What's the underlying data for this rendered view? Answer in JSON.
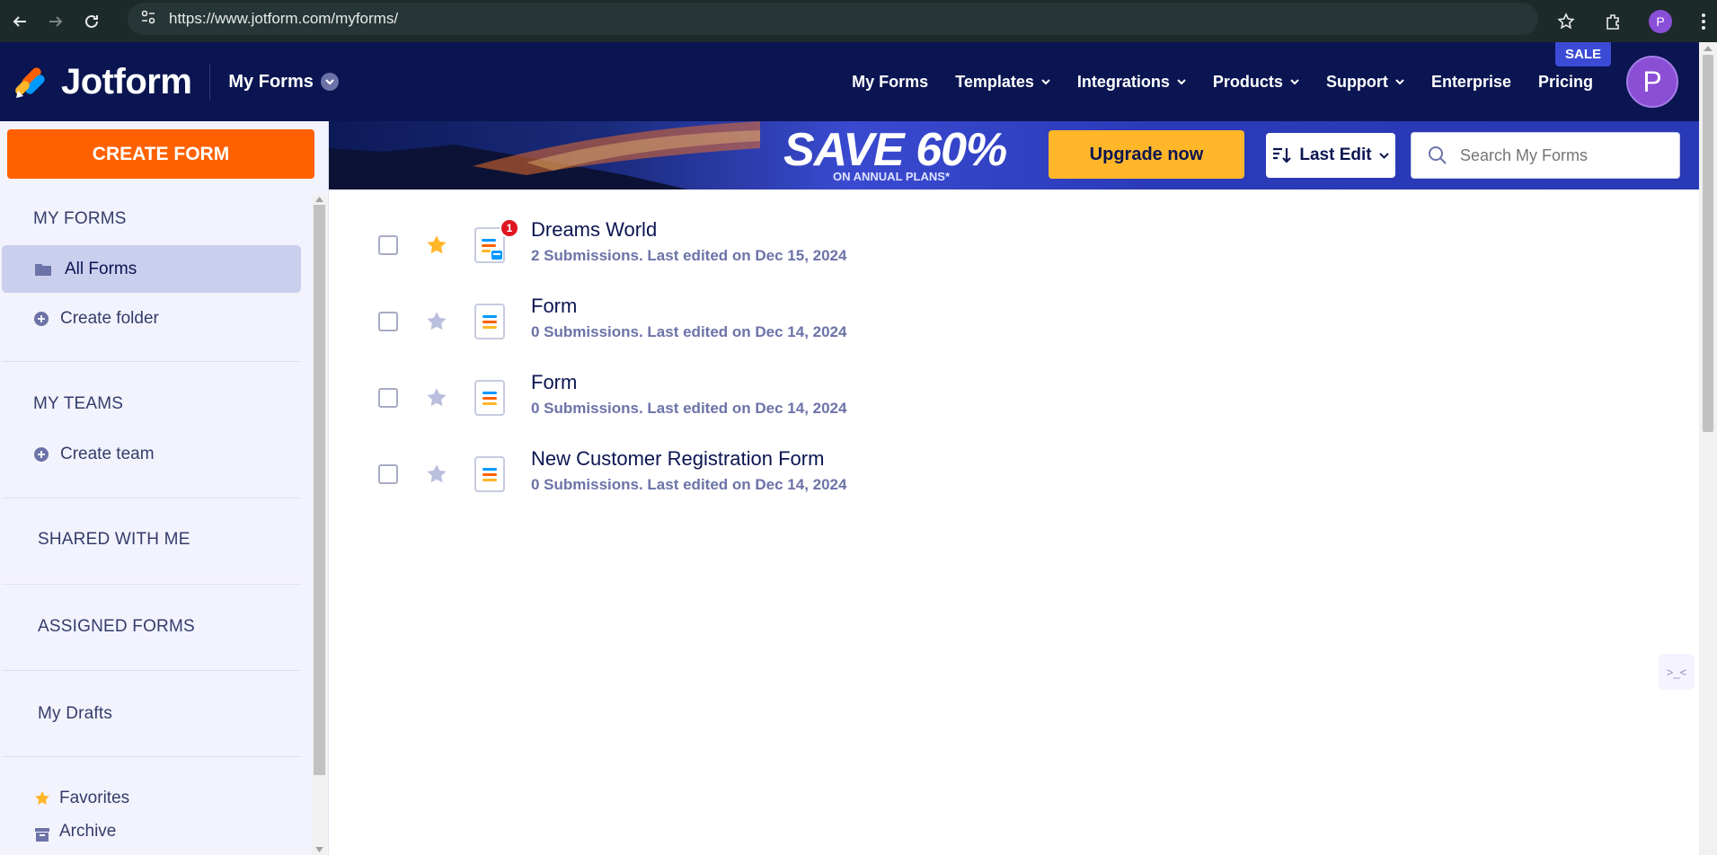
{
  "browser": {
    "url": "https://www.jotform.com/myforms/",
    "profile_initial": "P"
  },
  "header": {
    "brand": "Jotform",
    "workspace": "My Forms",
    "nav": [
      {
        "label": "My Forms"
      },
      {
        "label": "Templates"
      },
      {
        "label": "Integrations"
      },
      {
        "label": "Products"
      },
      {
        "label": "Support"
      },
      {
        "label": "Enterprise"
      },
      {
        "label": "Pricing"
      }
    ],
    "sale_badge": "SALE",
    "avatar_initial": "P"
  },
  "sidebar": {
    "create_form": "CREATE FORM",
    "my_forms_title": "MY FORMS",
    "all_forms": "All Forms",
    "create_folder": "Create folder",
    "my_teams_title": "MY TEAMS",
    "create_team": "Create team",
    "shared_with_me": "SHARED WITH ME",
    "assigned_forms": "ASSIGNED FORMS",
    "my_drafts": "My Drafts",
    "favorites": "Favorites",
    "archive": "Archive"
  },
  "banner": {
    "headline": "SAVE 60%",
    "subline": "ON ANNUAL PLANS*",
    "upgrade": "Upgrade now"
  },
  "toolbar": {
    "sort_label": "Last Edit",
    "search_placeholder": "Search My Forms"
  },
  "forms": [
    {
      "title": "Dreams World",
      "meta": "2 Submissions. Last edited on Dec 15, 2024",
      "starred": true,
      "badge": "1"
    },
    {
      "title": "Form",
      "meta": "0 Submissions. Last edited on Dec 14, 2024",
      "starred": false
    },
    {
      "title": "Form",
      "meta": "0 Submissions. Last edited on Dec 14, 2024",
      "starred": false
    },
    {
      "title": "New Customer Registration Form",
      "meta": "0 Submissions. Last edited on Dec 14, 2024",
      "starred": false
    }
  ],
  "colors": {
    "nav_bg": "#0a1551",
    "create_btn": "#ff6100",
    "upgrade_btn": "#ffb629",
    "star_active": "#ffb629",
    "star_inactive": "#b9bfdc"
  }
}
